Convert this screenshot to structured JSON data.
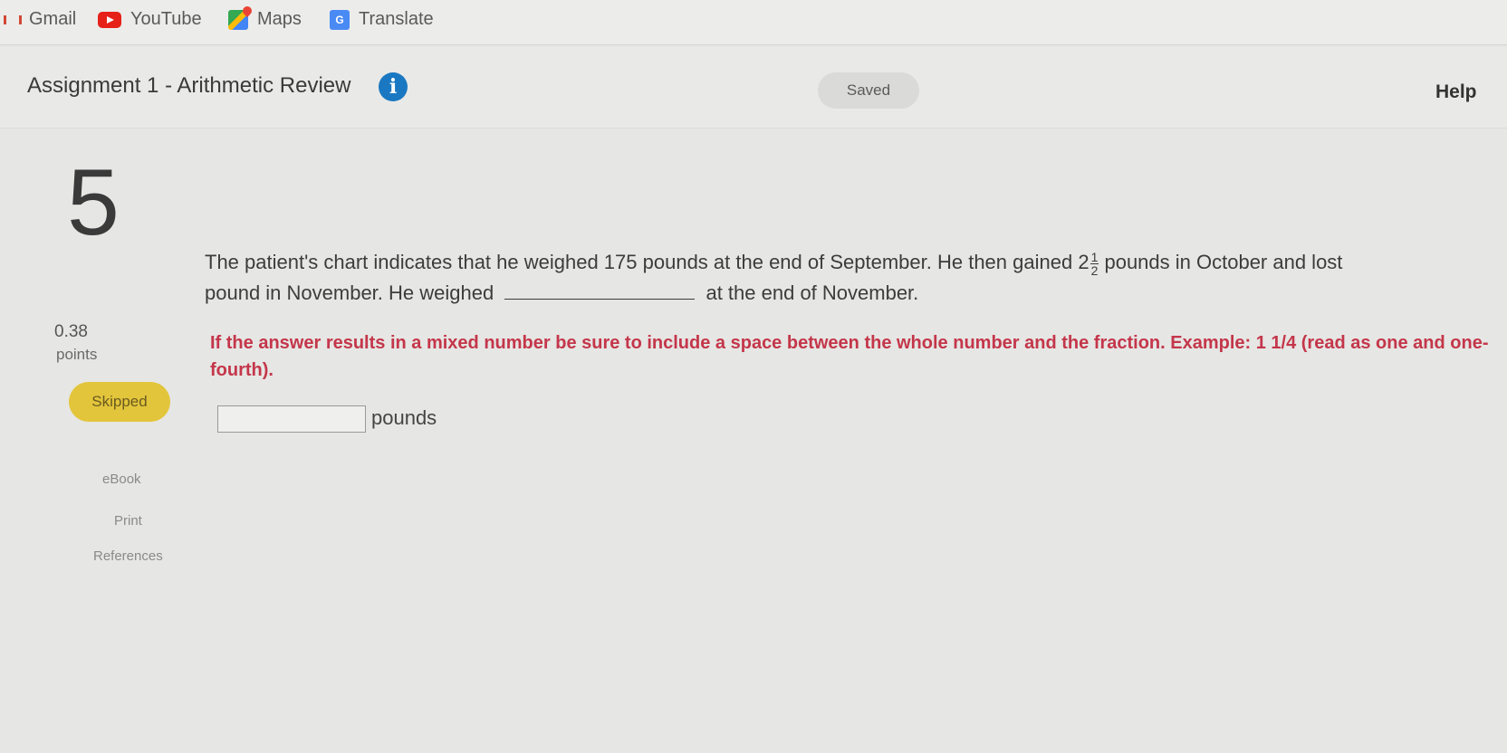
{
  "bookmarks": [
    {
      "label": "Gmail",
      "icon": "gmail-icon"
    },
    {
      "label": "YouTube",
      "icon": "youtube-icon"
    },
    {
      "label": "Maps",
      "icon": "maps-icon"
    },
    {
      "label": "Translate",
      "icon": "translate-icon"
    }
  ],
  "header": {
    "title": "Assignment 1 - Arithmetic Review",
    "info_icon": "i",
    "saved_label": "Saved",
    "help_label": "Help"
  },
  "question": {
    "number": "5",
    "points_value": "0.38",
    "points_label": "points",
    "status_label": "Skipped",
    "text_part1": "The patient's chart indicates that he weighed 175 pounds at the end of September. He then gained 2",
    "fraction_numerator": "1",
    "fraction_denominator": "2",
    "text_part2": " pounds in October and lost",
    "text_part3": "pound in November. He weighed",
    "text_part4": "at the end of November.",
    "instruction": "If the answer results in a mixed number be sure to include a space between the whole number and the fraction. Example: 1 1/4 (read as one and one-fourth).",
    "answer_value": "",
    "unit_label": "pounds"
  },
  "side_links": {
    "ebook": "eBook",
    "print": "Print",
    "references": "References"
  },
  "colors": {
    "accent_blue": "#1a78c2",
    "instruction_red": "#c4364a",
    "skipped_yellow": "#e3c53b"
  }
}
